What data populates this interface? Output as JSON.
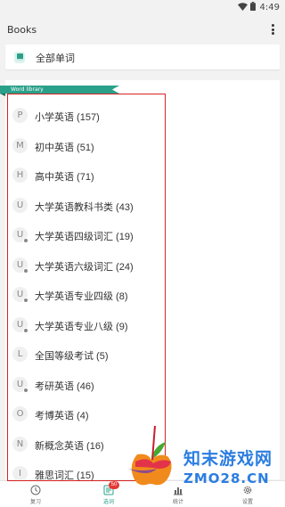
{
  "status_bar": {
    "time": "4:49",
    "icons": [
      "wifi-icon",
      "battery-icon"
    ]
  },
  "header": {
    "title": "Books"
  },
  "all_words": {
    "label": "全部单词",
    "icon": "book-icon"
  },
  "library": {
    "ribbon_label": "Word library",
    "items": [
      {
        "letter": "P",
        "label": "小学英语 (157)",
        "badge": false
      },
      {
        "letter": "M",
        "label": "初中英语 (51)",
        "badge": false
      },
      {
        "letter": "H",
        "label": "高中英语 (71)",
        "badge": false
      },
      {
        "letter": "U",
        "label": "大学英语教科书类 (43)",
        "badge": false
      },
      {
        "letter": "U",
        "label": "大学英语四级词汇 (19)",
        "badge": true
      },
      {
        "letter": "U",
        "label": "大学英语六级词汇 (24)",
        "badge": true
      },
      {
        "letter": "U",
        "label": "大学英语专业四级 (8)",
        "badge": true
      },
      {
        "letter": "U",
        "label": "大学英语专业八级 (9)",
        "badge": true
      },
      {
        "letter": "L",
        "label": "全国等级考试 (5)",
        "badge": false
      },
      {
        "letter": "U",
        "label": "考研英语 (46)",
        "badge": true
      },
      {
        "letter": "O",
        "label": "考博英语 (4)",
        "badge": false
      },
      {
        "letter": "N",
        "label": "新概念英语 (16)",
        "badge": false
      },
      {
        "letter": "I",
        "label": "雅思词汇 (15)",
        "badge": false
      }
    ]
  },
  "bottom_nav": {
    "items": [
      {
        "label": "复习",
        "icon": "clock-icon"
      },
      {
        "label": "选词",
        "icon": "book-list-icon",
        "badge": "50",
        "active": true
      },
      {
        "label": "统计",
        "icon": "chart-icon"
      },
      {
        "label": "设置",
        "icon": "gear-icon"
      }
    ]
  },
  "watermark": {
    "cn": "知末游戏网",
    "en": "ZMO28.CN"
  },
  "colors": {
    "accent": "#2aa08a",
    "highlight": "#d72222",
    "badge": "#e53935",
    "watermark": "#2b7de0"
  }
}
